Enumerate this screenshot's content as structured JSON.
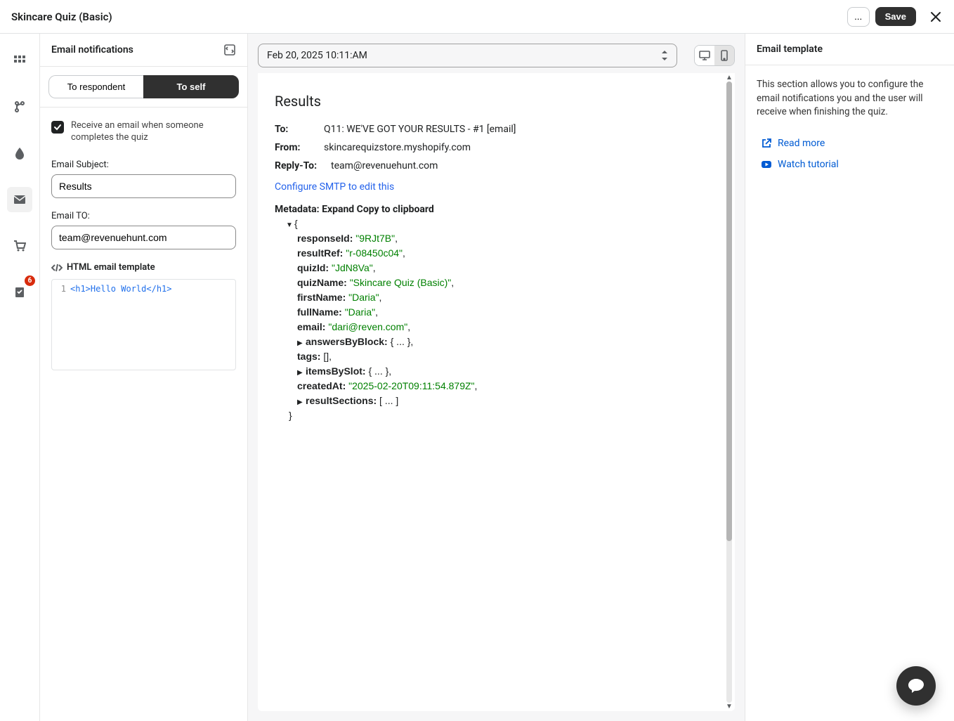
{
  "topbar": {
    "title": "Skincare Quiz (Basic)",
    "more": "...",
    "save": "Save"
  },
  "iconbar": {
    "badge": "6"
  },
  "leftpanel": {
    "heading": "Email notifications",
    "tabs": {
      "respondent": "To respondent",
      "self": "To self"
    },
    "checkbox_label": "Receive an email when someone completes the quiz",
    "subject_label": "Email Subject:",
    "subject_value": "Results",
    "to_label": "Email TO:",
    "to_value": "team@revenuehunt.com",
    "template_label": "HTML email template",
    "code_line_no": "1",
    "code_line": "<h1>Hello World</h1>"
  },
  "center": {
    "date": "Feb 20, 2025 10:11:AM",
    "results_heading": "Results",
    "label_to": "To:",
    "value_to": "Q11: WE'VE GOT YOUR RESULTS - #1 [email]",
    "label_from": "From:",
    "value_from": "skincarequizstore.myshopify.com",
    "label_reply": "Reply-To:",
    "value_reply": "team@revenuehunt.com",
    "smtp_link": "Configure SMTP to edit this",
    "metadata_prefix": "Metadata: ",
    "metadata_expand": "Expand",
    "metadata_copy": "Copy to clipboard",
    "json": {
      "responseId_k": "responseId:",
      "responseId_v": "\"9RJt7B\"",
      "resultRef_k": "resultRef:",
      "resultRef_v": "\"r-08450c04\"",
      "quizId_k": "quizId:",
      "quizId_v": "\"JdN8Va\"",
      "quizName_k": "quizName:",
      "quizName_v": "\"Skincare Quiz (Basic)\"",
      "firstName_k": "firstName:",
      "firstName_v": "\"Daria\"",
      "fullName_k": "fullName:",
      "fullName_v": "\"Daria\"",
      "email_k": "email:",
      "email_v": "\"dari@reven.com\"",
      "answersByBlock_k": "answersByBlock:",
      "answersByBlock_v": "{ ... }",
      "tags_k": "tags:",
      "tags_v": "[]",
      "itemsBySlot_k": "itemsBySlot:",
      "itemsBySlot_v": "{ ... }",
      "createdAt_k": "createdAt:",
      "createdAt_v": "\"2025-02-20T09:11:54.879Z\"",
      "resultSections_k": "resultSections:",
      "resultSections_v": "[ ... ]"
    }
  },
  "rightpanel": {
    "heading": "Email template",
    "description": "This section allows you to configure the email notifications you and the user will receive when finishing the quiz.",
    "read_more": "Read more",
    "watch_tutorial": "Watch tutorial"
  }
}
